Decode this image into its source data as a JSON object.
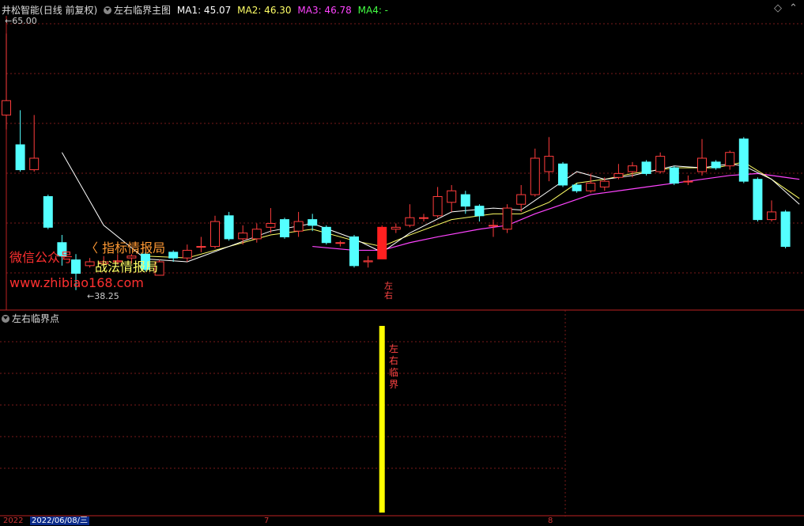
{
  "header": {
    "stock": "井松智能",
    "period": "(日线 前复权)",
    "indicator": "左右临界主图",
    "ma1_label": "MA1: 45.07",
    "ma2_label": "MA2: 46.30",
    "ma3_label": "MA3: 46.78",
    "ma4_label": "MA4: -",
    "colors": {
      "ma1": "#ffffff",
      "ma2": "#ffff66",
      "ma3": "#ff44ff",
      "ma4": "#44ff44"
    }
  },
  "subpanel": {
    "title": "左右临界点"
  },
  "watermark": {
    "line1": "微信公众号",
    "line2a": "指标情报局",
    "line2b": "战法情报局",
    "line3": "www.zhibiao168.com"
  },
  "markers": {
    "main_label_1": "左",
    "main_label_2": "右",
    "sub_label": [
      "左",
      "右",
      "临",
      "界"
    ]
  },
  "axis": {
    "date_left": "2022",
    "date_cursor": "2022/06/08/三",
    "month_7": "7",
    "month_8": "8"
  },
  "chart_data": {
    "type": "candlestick",
    "y_range": [
      36.5,
      67.5
    ],
    "max_label": "65.00",
    "min_label": "38.25",
    "candles": [
      {
        "o": 56.5,
        "c": 58.0,
        "h": 65.0,
        "l": 55.0
      },
      {
        "o": 53.4,
        "c": 50.8,
        "h": 57.0,
        "l": 50.6
      },
      {
        "o": 50.8,
        "c": 52.0,
        "h": 56.5,
        "l": 50.6
      },
      {
        "o": 48.0,
        "c": 44.8,
        "h": 48.2,
        "l": 44.6
      },
      {
        "o": 43.2,
        "c": 41.8,
        "h": 44.0,
        "l": 40.8
      },
      {
        "o": 41.4,
        "c": 40.0,
        "h": 42.0,
        "l": 38.25
      },
      {
        "o": 40.8,
        "c": 41.2,
        "h": 41.6,
        "l": 40.6
      },
      {
        "o": 41.0,
        "c": 41.2,
        "h": 41.8,
        "l": 40.6
      },
      {
        "o": 41.2,
        "c": 41.3,
        "h": 42.0,
        "l": 40.9
      },
      {
        "o": 41.6,
        "c": 41.8,
        "h": 42.0,
        "l": 41.0
      },
      {
        "o": 42.0,
        "c": 40.4,
        "h": 42.2,
        "l": 40.2
      },
      {
        "o": 39.8,
        "c": 41.2,
        "h": 41.4,
        "l": 39.8
      },
      {
        "o": 42.2,
        "c": 41.6,
        "h": 42.4,
        "l": 41.2
      },
      {
        "o": 41.6,
        "c": 42.4,
        "h": 43.0,
        "l": 41.2
      },
      {
        "o": 42.8,
        "c": 42.8,
        "h": 43.8,
        "l": 42.2
      },
      {
        "o": 42.8,
        "c": 45.4,
        "h": 46.0,
        "l": 42.6
      },
      {
        "o": 46.0,
        "c": 43.6,
        "h": 46.4,
        "l": 43.4
      },
      {
        "o": 43.6,
        "c": 44.2,
        "h": 45.0,
        "l": 43.0
      },
      {
        "o": 43.6,
        "c": 44.6,
        "h": 45.2,
        "l": 43.2
      },
      {
        "o": 44.8,
        "c": 45.2,
        "h": 46.8,
        "l": 44.2
      },
      {
        "o": 45.6,
        "c": 43.8,
        "h": 45.8,
        "l": 43.6
      },
      {
        "o": 44.4,
        "c": 45.4,
        "h": 46.4,
        "l": 43.8
      },
      {
        "o": 45.6,
        "c": 45.0,
        "h": 46.2,
        "l": 44.4
      },
      {
        "o": 44.8,
        "c": 43.2,
        "h": 45.0,
        "l": 43.0
      },
      {
        "o": 43.2,
        "c": 43.2,
        "h": 43.4,
        "l": 42.8
      },
      {
        "o": 43.8,
        "c": 40.8,
        "h": 44.0,
        "l": 40.6
      },
      {
        "o": 41.2,
        "c": 41.3,
        "h": 41.8,
        "l": 40.6
      },
      {
        "o": 41.5,
        "c": 44.8,
        "h": 45.0,
        "l": 41.5,
        "highlight": true
      },
      {
        "o": 44.6,
        "c": 44.8,
        "h": 45.2,
        "l": 44.2
      },
      {
        "o": 45.0,
        "c": 45.8,
        "h": 47.2,
        "l": 44.8
      },
      {
        "o": 45.8,
        "c": 45.8,
        "h": 46.2,
        "l": 45.4
      },
      {
        "o": 46.0,
        "c": 48.0,
        "h": 49.0,
        "l": 45.8
      },
      {
        "o": 47.4,
        "c": 48.6,
        "h": 49.2,
        "l": 46.4
      },
      {
        "o": 48.2,
        "c": 47.0,
        "h": 48.6,
        "l": 46.2
      },
      {
        "o": 47.0,
        "c": 46.0,
        "h": 47.2,
        "l": 45.4
      },
      {
        "o": 45.0,
        "c": 45.0,
        "h": 45.6,
        "l": 43.8
      },
      {
        "o": 44.6,
        "c": 46.8,
        "h": 47.2,
        "l": 44.2
      },
      {
        "o": 47.2,
        "c": 48.2,
        "h": 49.2,
        "l": 46.4
      },
      {
        "o": 48.2,
        "c": 52.0,
        "h": 53.0,
        "l": 48.0
      },
      {
        "o": 50.6,
        "c": 52.2,
        "h": 54.2,
        "l": 49.6
      },
      {
        "o": 51.4,
        "c": 49.2,
        "h": 51.6,
        "l": 49.0
      },
      {
        "o": 49.2,
        "c": 48.6,
        "h": 49.4,
        "l": 48.4
      },
      {
        "o": 48.6,
        "c": 49.4,
        "h": 50.4,
        "l": 48.4
      },
      {
        "o": 49.0,
        "c": 49.6,
        "h": 50.0,
        "l": 48.6
      },
      {
        "o": 50.0,
        "c": 50.4,
        "h": 51.4,
        "l": 49.8
      },
      {
        "o": 50.6,
        "c": 51.2,
        "h": 51.6,
        "l": 50.0
      },
      {
        "o": 51.6,
        "c": 50.4,
        "h": 51.8,
        "l": 50.2
      },
      {
        "o": 50.6,
        "c": 52.2,
        "h": 52.6,
        "l": 50.4
      },
      {
        "o": 51.0,
        "c": 49.4,
        "h": 51.2,
        "l": 49.2
      },
      {
        "o": 49.6,
        "c": 49.6,
        "h": 50.2,
        "l": 49.2
      },
      {
        "o": 50.6,
        "c": 52.0,
        "h": 54.0,
        "l": 50.2
      },
      {
        "o": 51.6,
        "c": 51.0,
        "h": 51.8,
        "l": 50.8
      },
      {
        "o": 51.2,
        "c": 52.6,
        "h": 52.8,
        "l": 50.8
      },
      {
        "o": 54.0,
        "c": 49.6,
        "h": 54.2,
        "l": 49.4
      },
      {
        "o": 49.8,
        "c": 45.6,
        "h": 50.0,
        "l": 45.4
      },
      {
        "o": 45.6,
        "c": 46.4,
        "h": 47.6,
        "l": 45.4
      },
      {
        "o": 46.4,
        "c": 42.8,
        "h": 46.6,
        "l": 42.6
      }
    ],
    "ma1": [
      [
        4,
        52.6
      ],
      [
        7,
        45.0
      ],
      [
        10,
        41.5
      ],
      [
        13,
        41.2
      ],
      [
        16,
        42.8
      ],
      [
        19,
        44.4
      ],
      [
        22,
        45.2
      ],
      [
        25,
        43.6
      ],
      [
        27,
        42.2
      ],
      [
        29,
        44.2
      ],
      [
        32,
        46.4
      ],
      [
        35,
        46.8
      ],
      [
        37,
        46.6
      ],
      [
        39,
        48.6
      ],
      [
        41,
        50.6
      ],
      [
        43,
        49.8
      ],
      [
        45,
        50.2
      ],
      [
        48,
        51.2
      ],
      [
        50,
        51.0
      ],
      [
        52,
        51.4
      ],
      [
        53,
        51.2
      ],
      [
        55,
        49.8
      ],
      [
        57,
        47.2
      ]
    ],
    "ma2": [
      [
        10,
        41.8
      ],
      [
        13,
        41.6
      ],
      [
        16,
        42.8
      ],
      [
        19,
        44.0
      ],
      [
        22,
        44.6
      ],
      [
        25,
        43.4
      ],
      [
        27,
        42.8
      ],
      [
        29,
        44.0
      ],
      [
        32,
        45.6
      ],
      [
        35,
        46.2
      ],
      [
        37,
        46.2
      ],
      [
        39,
        47.4
      ],
      [
        41,
        49.4
      ],
      [
        43,
        49.8
      ],
      [
        45,
        50.4
      ],
      [
        48,
        51.0
      ],
      [
        51,
        51.0
      ],
      [
        53,
        51.6
      ],
      [
        55,
        49.8
      ],
      [
        57,
        47.8
      ]
    ],
    "ma3": [
      [
        22,
        42.8
      ],
      [
        25,
        42.4
      ],
      [
        27,
        42.4
      ],
      [
        29,
        43.2
      ],
      [
        31,
        43.8
      ],
      [
        34,
        44.6
      ],
      [
        36,
        45.0
      ],
      [
        38,
        46.2
      ],
      [
        40,
        47.2
      ],
      [
        42,
        48.2
      ],
      [
        44,
        48.6
      ],
      [
        46,
        49.0
      ],
      [
        48,
        49.4
      ],
      [
        50,
        49.8
      ],
      [
        52,
        50.2
      ],
      [
        54,
        50.4
      ],
      [
        56,
        50.0
      ],
      [
        57,
        49.8
      ]
    ]
  }
}
